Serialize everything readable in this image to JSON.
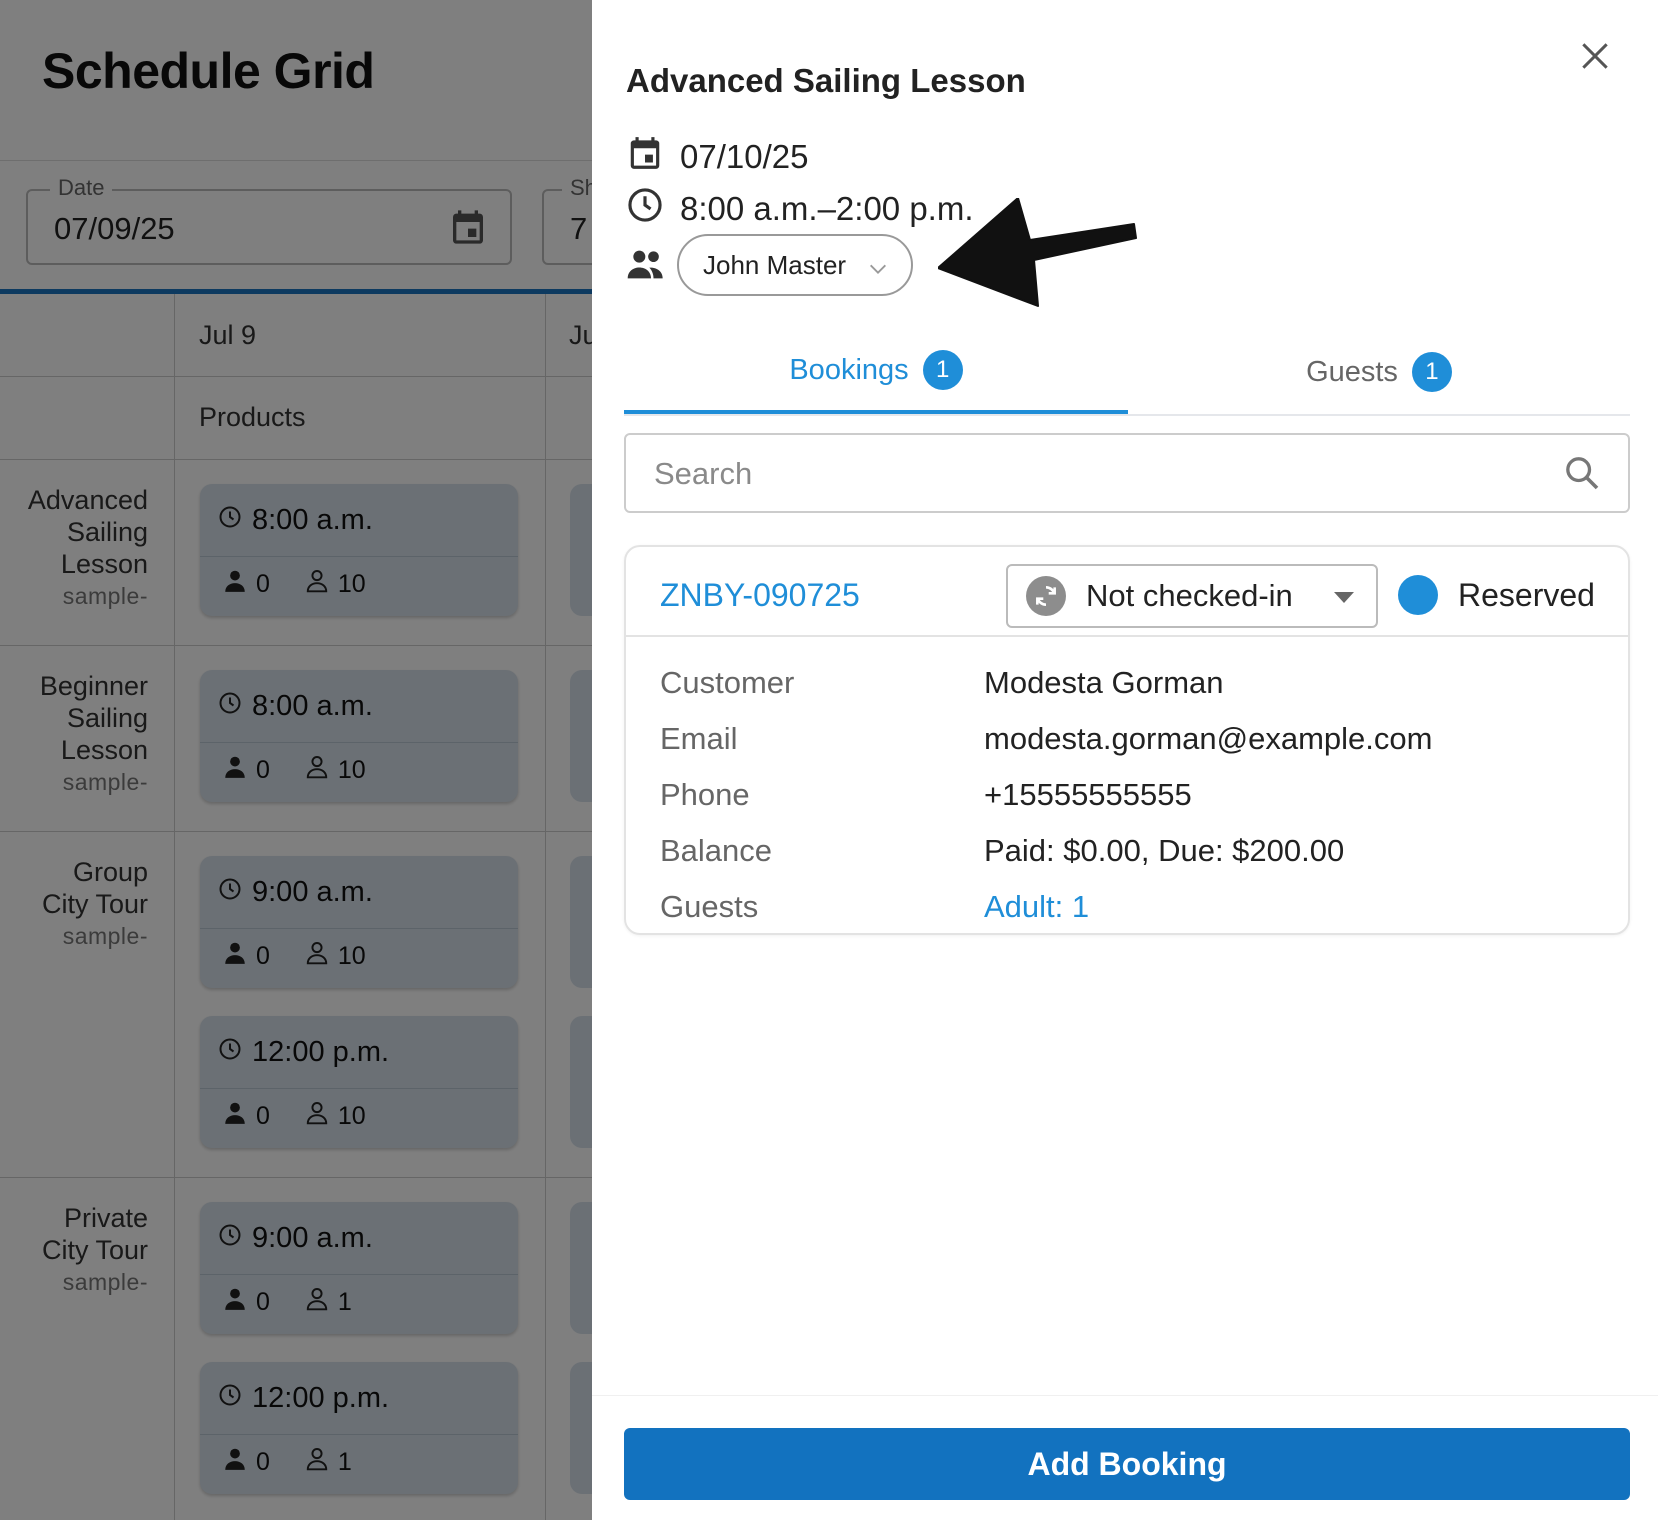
{
  "background": {
    "page_title": "Schedule Grid",
    "filters": {
      "date_label": "Date",
      "date_value": "07/09/25",
      "second_label": "Sh",
      "second_value": "7"
    },
    "grid": {
      "col1_header": "Jul 9",
      "col2_header": "Ju",
      "subheader": "Products",
      "rows": [
        {
          "name_lines": [
            "Advanced",
            "Sailing",
            "Lesson"
          ],
          "sub": "sample-"
        },
        {
          "name_lines": [
            "Beginner",
            "Sailing",
            "Lesson"
          ],
          "sub": "sample-"
        },
        {
          "name_lines": [
            "Group",
            "City Tour"
          ],
          "sub": "sample-"
        },
        {
          "name_lines": [
            "Private",
            "City Tour"
          ],
          "sub": "sample-"
        }
      ],
      "slots": [
        {
          "time": "8:00 a.m.",
          "booked": "0",
          "capacity": "10"
        },
        {
          "time": "8:00 a.m.",
          "booked": "0",
          "capacity": "10"
        },
        {
          "time": "9:00 a.m.",
          "booked": "0",
          "capacity": "10"
        },
        {
          "time": "12:00 p.m.",
          "booked": "0",
          "capacity": "10"
        },
        {
          "time": "9:00 a.m.",
          "booked": "0",
          "capacity": "1"
        },
        {
          "time": "12:00 p.m.",
          "booked": "0",
          "capacity": "1"
        }
      ]
    }
  },
  "panel": {
    "title": "Advanced Sailing Lesson",
    "date": "07/10/25",
    "time_range": "8:00 a.m.–2:00 p.m.",
    "staff": "John Master",
    "tabs": [
      {
        "label": "Bookings",
        "count": "1"
      },
      {
        "label": "Guests",
        "count": "1"
      }
    ],
    "search_placeholder": "Search",
    "booking": {
      "id": "ZNBY-090725",
      "checkin_status": "Not checked-in",
      "status": "Reserved",
      "fields": [
        {
          "label": "Customer",
          "value": "Modesta Gorman"
        },
        {
          "label": "Email",
          "value": "modesta.gorman@example.com"
        },
        {
          "label": "Phone",
          "value": "+15555555555"
        },
        {
          "label": "Balance",
          "value": "Paid: $0.00, Due: $200.00"
        },
        {
          "label": "Guests",
          "value": "Adult: 1"
        }
      ]
    },
    "add_button": "Add Booking"
  },
  "colors": {
    "accent": "#1f8ed8",
    "primary_button": "#1272bf",
    "slot_bg": "#d7e1ea"
  },
  "icons": [
    "calendar-icon",
    "clock-icon",
    "people-icon",
    "chevron-down-icon",
    "close-icon",
    "search-icon",
    "sync-icon",
    "arrow-annotation",
    "person-filled-icon",
    "person-outline-icon"
  ]
}
